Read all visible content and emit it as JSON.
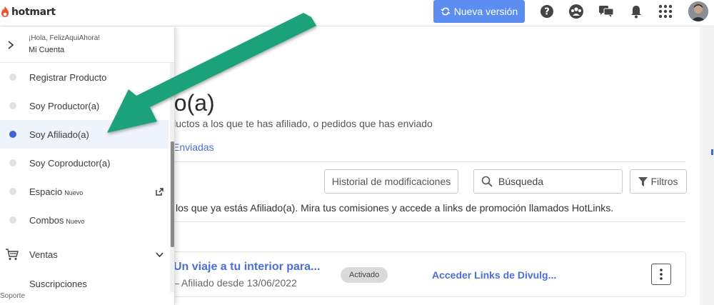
{
  "header": {
    "logo_text": "hotmart",
    "new_version_label": "Nueva versión",
    "icons": [
      "help-icon",
      "community-icon",
      "chat-icon",
      "bell-icon",
      "apps-grid-icon",
      "user-avatar"
    ]
  },
  "sidebar": {
    "greeting": "¡Hola, FelizAquiAhora!",
    "account_label": "Mi Cuenta",
    "items": [
      {
        "label": "Registrar Producto",
        "badge": ""
      },
      {
        "label": "Soy Productor(a)",
        "badge": ""
      },
      {
        "label": "Soy Afiliado(a)",
        "badge": "",
        "active": true
      },
      {
        "label": "Soy Coproductor(a)",
        "badge": ""
      },
      {
        "label": "Espacio",
        "badge": "Nuevo"
      },
      {
        "label": "Combos",
        "badge": "Nuevo"
      },
      {
        "label": "Ventas",
        "badge": ""
      },
      {
        "label": "Suscripciones",
        "badge": ""
      }
    ],
    "support_label": "Soporte"
  },
  "main": {
    "title_partial": "do(a)",
    "subtitle_partial": "roductos a los que te has afiliado, o pedidos que has enviado",
    "tab_enviadas": "Enviadas",
    "history_button": "Historial de modificaciones",
    "search_placeholder": "Búsqueda",
    "filters_button": "Filtros",
    "info_text": "los que ya estás Afiliado(a). Mira tus comisiones y accede a links de promoción llamados HotLinks.",
    "card": {
      "title": "Un viaje a tu interior para...",
      "subtitle": "– Afiliado desde 13/06/2022",
      "status": "Activado",
      "link": "Acceder Links de Divulg..."
    }
  },
  "colors": {
    "accent": "#4a6fd6",
    "new_version_bg": "#5b8ef0",
    "arrow": "#1fa27a",
    "active_dot": "#3d63d4"
  }
}
